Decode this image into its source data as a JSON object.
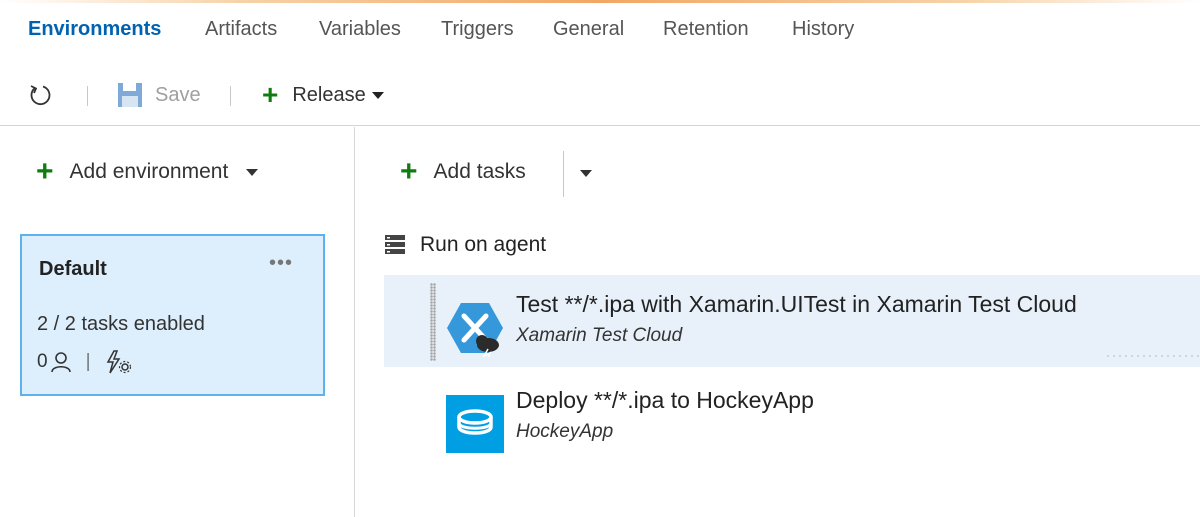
{
  "tabs": [
    {
      "label": "Environments",
      "active": true
    },
    {
      "label": "Artifacts"
    },
    {
      "label": "Variables"
    },
    {
      "label": "Triggers"
    },
    {
      "label": "General"
    },
    {
      "label": "Retention"
    },
    {
      "label": "History"
    }
  ],
  "toolbar": {
    "refresh_icon": "refresh-icon",
    "save_label": "Save",
    "save_icon": "save-icon",
    "release_label": "Release"
  },
  "left": {
    "add_environment_label": "Add environment",
    "environment": {
      "name": "Default",
      "tasks_enabled": "2 / 2 tasks enabled",
      "approvers_count": "0"
    }
  },
  "right": {
    "add_tasks_label": "Add tasks",
    "phase_label": "Run on agent",
    "tasks": [
      {
        "title": "Test **/*.ipa with Xamarin.UITest in Xamarin Test Cloud",
        "subtitle": "Xamarin Test Cloud",
        "icon": "xamarin-icon",
        "selected": true
      },
      {
        "title": "Deploy **/*.ipa to HockeyApp",
        "subtitle": "HockeyApp",
        "icon": "hockeyapp-icon",
        "selected": false
      }
    ]
  },
  "colors": {
    "accent": "#0063b1",
    "plus": "#107c10",
    "card_bg": "#ddeefc",
    "card_border": "#5fb1eb",
    "selected_row": "#e8f1f9",
    "xamarin": "#3498db",
    "hockeyapp": "#009fe3"
  }
}
